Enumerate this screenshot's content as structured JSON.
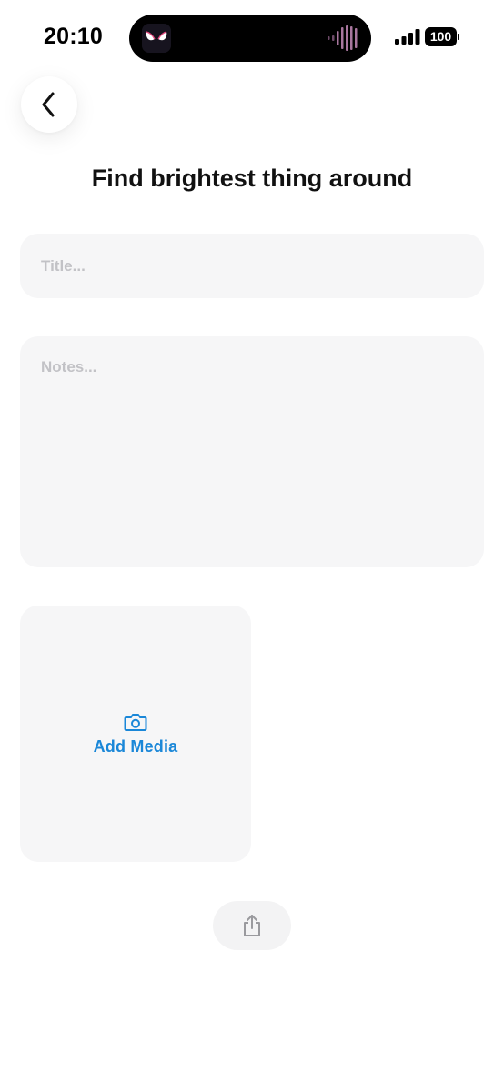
{
  "status_bar": {
    "time": "20:10",
    "battery_level": "100",
    "icons": [
      "app-icon",
      "audio-wave-icon",
      "cellular-signal-icon",
      "battery-icon"
    ]
  },
  "nav": {
    "back_icon": "chevron-left-icon"
  },
  "page": {
    "title": "Find brightest thing around"
  },
  "form": {
    "title_placeholder": "Title...",
    "title_value": "",
    "notes_placeholder": "Notes...",
    "notes_value": ""
  },
  "media": {
    "icon": "camera-icon",
    "label": "Add Media"
  },
  "share": {
    "icon": "share-icon"
  },
  "colors": {
    "accent": "#1a87d8",
    "field_bg": "#f6f6f7",
    "placeholder": "#c2c2c6"
  }
}
